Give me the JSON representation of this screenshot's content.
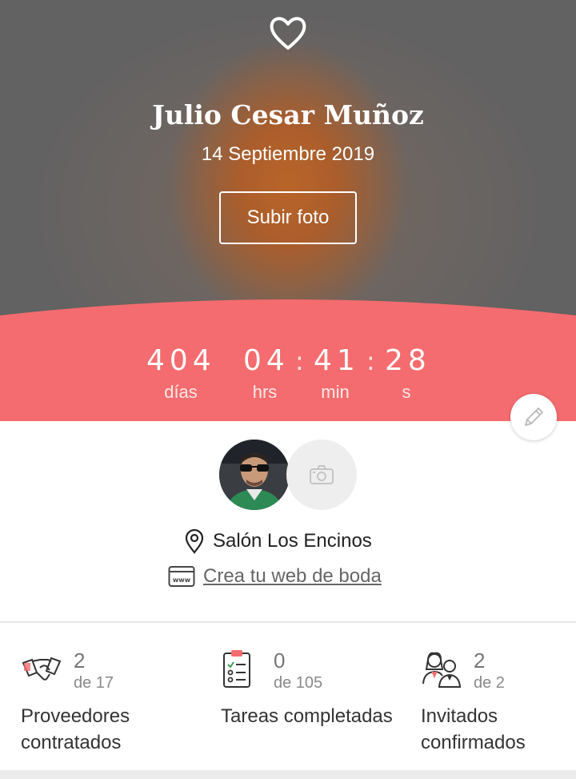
{
  "hero": {
    "name": "Julio Cesar Muñoz",
    "date": "14 Septiembre 2019",
    "upload_label": "Subir foto"
  },
  "countdown": {
    "days": "404",
    "hours": "04",
    "minutes": "41",
    "seconds": "28",
    "separator": ":",
    "days_label": "días",
    "hours_label": "hrs",
    "minutes_label": "min",
    "seconds_label": "s"
  },
  "profile": {
    "venue": "Salón Los Encinos",
    "web_link": "Crea tu web de boda",
    "web_icon_text": "www"
  },
  "stats": [
    {
      "count": "2",
      "of": "de 17",
      "label": "Proveedores contratados",
      "icon": "handshake-icon"
    },
    {
      "count": "0",
      "of": "de 105",
      "label": "Tareas completadas",
      "icon": "checklist-icon"
    },
    {
      "count": "2",
      "of": "de 2",
      "label": "Invitados confirmados",
      "icon": "guests-icon"
    }
  ],
  "colors": {
    "accent": "#f46c6f",
    "text": "#333333",
    "muted": "#8a8a8a"
  }
}
